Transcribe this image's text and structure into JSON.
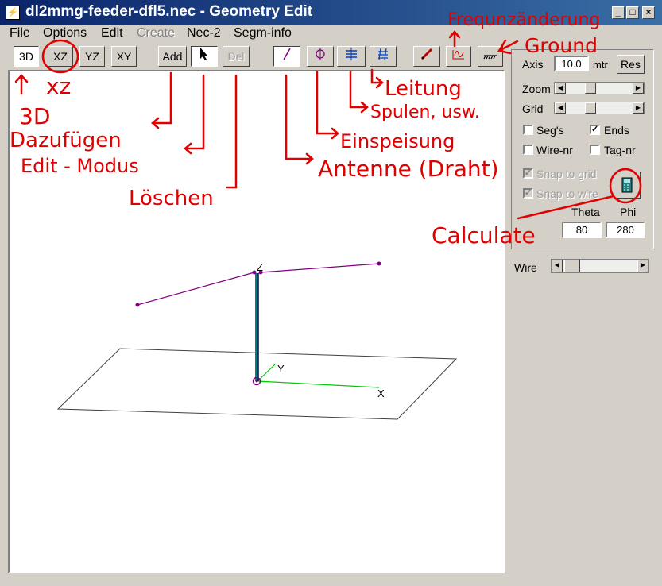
{
  "window": {
    "title": "dl2mmg-feeder-dfl5.nec - Geometry Edit",
    "icon": "app-icon"
  },
  "menu": [
    "File",
    "Options",
    "Edit",
    "Create",
    "Nec-2",
    "Segm-info"
  ],
  "toolbar": {
    "view_3d": "3D",
    "view_xz": "XZ",
    "view_yz": "YZ",
    "view_xy": "XY",
    "add": "Add",
    "del": "Del"
  },
  "panel": {
    "axis_label": "Axis",
    "axis_value": "10.0",
    "axis_unit": "mtr",
    "res_button": "Res",
    "zoom_label": "Zoom",
    "grid_label": "Grid",
    "segs_label": "Seg's",
    "ends_label": "Ends",
    "wirenr_label": "Wire-nr",
    "tagnr_label": "Tag-nr",
    "snap_grid_label": "Snap to grid",
    "snap_wire_label": "Snap to wire",
    "theta_label": "Theta",
    "phi_label": "Phi",
    "theta_value": "80",
    "phi_value": "280",
    "wire_label": "Wire"
  },
  "axes": {
    "z": "Z",
    "y": "Y",
    "x": "X"
  },
  "annotations": {
    "xz": "xz",
    "3d": "3D",
    "dazufugen": "Dazufügen",
    "editmodus": "Edit - Modus",
    "loschen": "Löschen",
    "antenne": "Antenne (Draht)",
    "einspeisung": "Einspeisung",
    "spulen": "Spulen, usw.",
    "leitung": "Leitung",
    "frequenz": "Frequnzänderung",
    "ground": "Ground",
    "calculate": "Calculate"
  },
  "colors": {
    "title_bg": "#0a246a",
    "wire": "#800080",
    "feed": "#008080",
    "axis_x": "#00cc00",
    "annotation": "#e00000"
  }
}
